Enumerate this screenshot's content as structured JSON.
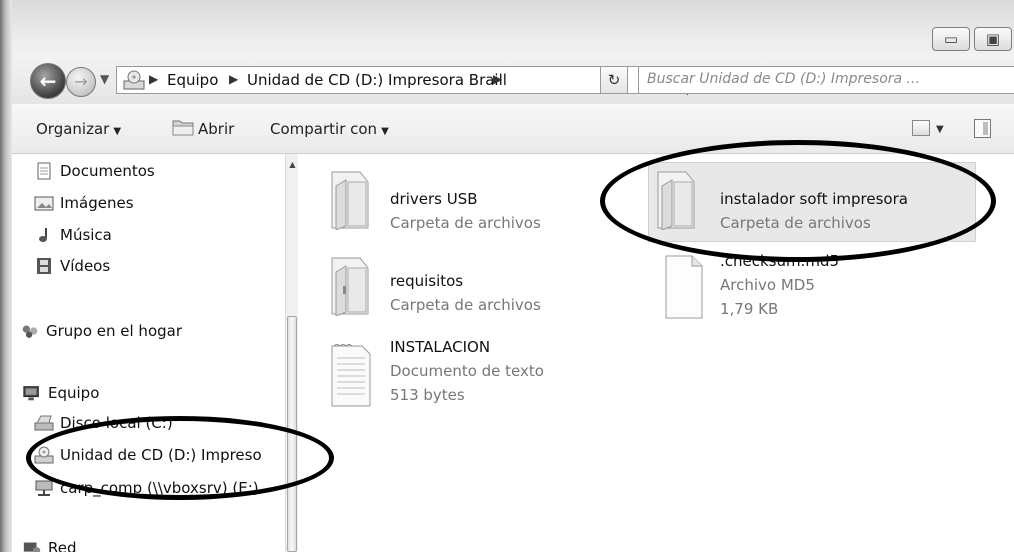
{
  "address_bar": {
    "crumbs": [
      "Equipo",
      "Unidad de CD (D:) Impresora Braill"
    ],
    "search_placeholder": "Buscar Unidad de CD (D:) Impresora ..."
  },
  "toolbar": {
    "organize": "Organizar",
    "open": "Abrir",
    "share": "Compartir con"
  },
  "navigation": {
    "items": [
      {
        "label": "Documentos",
        "icon": "document-icon"
      },
      {
        "label": "Imágenes",
        "icon": "image-icon"
      },
      {
        "label": "Música",
        "icon": "music-icon"
      },
      {
        "label": "Vídeos",
        "icon": "video-icon"
      },
      {
        "label": "Grupo en el hogar",
        "icon": "homegroup-icon"
      },
      {
        "label": "Equipo",
        "icon": "computer-icon"
      },
      {
        "label": "Disco local (C:)",
        "icon": "disk-icon"
      },
      {
        "label": "Unidad de CD (D:) Impreso",
        "icon": "cd-drive-icon"
      },
      {
        "label": "carp_comp (\\\\vboxsrv) (E:)",
        "icon": "network-drive-icon"
      },
      {
        "label": "Red",
        "icon": "network-icon"
      }
    ]
  },
  "files": [
    {
      "name": "drivers USB",
      "type": "Carpeta de archivos",
      "icon": "folder-icon"
    },
    {
      "name": "instalador soft impresora",
      "type": "Carpeta de archivos",
      "icon": "folder-icon"
    },
    {
      "name": "requisitos",
      "type": "Carpeta de archivos",
      "icon": "folder-icon"
    },
    {
      "name": ".checksum.md5",
      "type": "Archivo MD5",
      "size": "1,79 KB",
      "icon": "file-icon"
    },
    {
      "name": "INSTALACION",
      "type": "Documento de texto",
      "size": "513 bytes",
      "icon": "text-file-icon"
    }
  ],
  "colors": {
    "annotation": "#000000",
    "selection": "#e8e8e8",
    "secondary_text": "#777777"
  }
}
